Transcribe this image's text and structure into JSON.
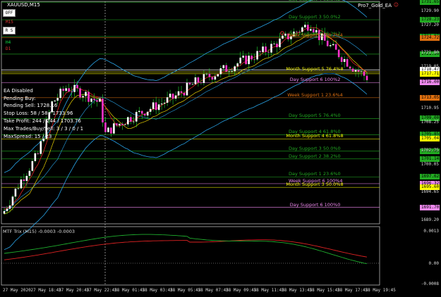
{
  "header": {
    "symbol": "XAUUSD,M15",
    "ea_name": "Pro7_Gold_EA"
  },
  "buttons": {
    "off": "OFF",
    "rs": "R S"
  },
  "timeframes": [
    {
      "label": "M15",
      "active": false
    },
    {
      "label": "H4",
      "active": true
    },
    {
      "label": "D1",
      "active": false
    }
  ],
  "info_panel": {
    "status": "EA Disabled",
    "pending_buy": "Pending Buy:",
    "pending_sell": "Pending Sell: 1728.16",
    "stop_loss": "Stop Loss: 58 / 58 / 1733.96",
    "take_profit": "Take Profit: 244 / 244 / 1703.76",
    "max_trades": "Max Trades/Buy/Sell: 3 / 3 / 0 / 1",
    "max_spread": "MaxSpread: 15 / 23"
  },
  "levels": [
    {
      "label": "Day Support 4 61.8%2",
      "price": "1731.65",
      "color": "#22aa22"
    },
    {
      "label": "Day Support 3 50.0%2",
      "price": "1728.23",
      "color": "#22aa22"
    },
    {
      "label": "Day Support 2 38.2%2",
      "price": "1724.97",
      "color": "#22aa22"
    },
    {
      "label": "Week Support 2 38.2%4",
      "price": "1724.72",
      "color": "#e07010"
    },
    {
      "label": "",
      "price": "1721.54",
      "color": "#22aa22"
    },
    {
      "label": "Month Support 5 76.4%8",
      "price": "1718.08",
      "color": "#ffff00"
    },
    {
      "label": "Day Support 6 100%2",
      "price": "1716.00",
      "color": "#ee88ee"
    },
    {
      "label": "Week Support 1 23.6%4",
      "price": "1713.05",
      "color": "#e07010"
    },
    {
      "label": "Day Support 5 76.4%0",
      "price": "1709.00",
      "color": "#22aa22"
    },
    {
      "label": "Day Support 4 61.8%0",
      "price": "1705.85",
      "color": "#22aa22"
    },
    {
      "label": "Month Support 4 61.8%8",
      "price": "1705.04",
      "color": "#ffff00"
    },
    {
      "label": "Day Support 3 50.0%0",
      "price": "1702.65",
      "color": "#22aa22"
    },
    {
      "label": "Day Support 2 38.2%0",
      "price": "1701.14",
      "color": "#22aa22"
    },
    {
      "label": "Day Support 1 23.6%0",
      "price": "1697.62",
      "color": "#22aa22"
    },
    {
      "label": "Week Support 6 100%4",
      "price": "1696.32",
      "color": "#ee88ee"
    },
    {
      "label": "Month Support 3 50.0%8",
      "price": "1695.60",
      "color": "#ffff00"
    },
    {
      "label": "Day Support 6 100%0",
      "price": "1691.70",
      "color": "#ee88ee"
    }
  ],
  "current_prices": {
    "bid": "1718.47",
    "ask": "1717.71",
    "bid_color": "#ffffff",
    "ask_color": "#ffff00"
  },
  "price_axis": [
    "1729.90",
    "1727.20",
    "1721.80",
    "1719.05",
    "1710.95",
    "1708.25",
    "1702.75",
    "1700.05",
    "1694.65",
    "1689.20"
  ],
  "indicator": {
    "title": "MTF Trix (M15) -0.0003 -0.0003",
    "axis": [
      "0.0013",
      "0.00",
      "-0.0008"
    ]
  },
  "time_axis": [
    "27 May 2020",
    "27 May 18:45",
    "27 May 20:45",
    "27 May 22:45",
    "28 May 01:45",
    "28 May 03:45",
    "28 May 05:45",
    "28 May 07:45",
    "28 May 09:45",
    "28 May 11:45",
    "28 May 13:45",
    "28 May 15:45",
    "28 May 17:45",
    "28 May 19:45"
  ],
  "colors": {
    "bull": "#ffffff",
    "bear": "#ff33cc",
    "wick": "#22dd33",
    "ma_red": "#ff2a2a",
    "ma_yellow": "#e8d100",
    "band": "#29a3e6",
    "trix_green": "#1fae2e",
    "trix_red": "#dd2222"
  }
}
